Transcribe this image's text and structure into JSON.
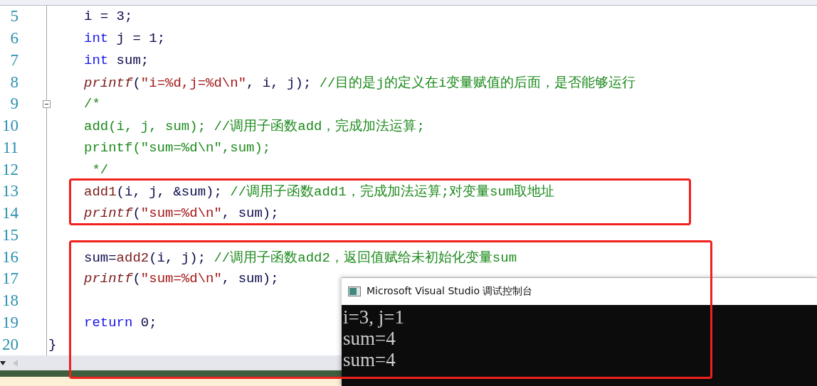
{
  "editor": {
    "lines": [
      {
        "number": "5",
        "indented": true,
        "tokens": [
          {
            "kind": "plain",
            "text": "i = 3;"
          }
        ]
      },
      {
        "number": "6",
        "indented": true,
        "tokens": [
          {
            "kind": "keyword",
            "text": "int"
          },
          {
            "kind": "plain",
            "text": " j = 1;"
          }
        ]
      },
      {
        "number": "7",
        "indented": true,
        "tokens": [
          {
            "kind": "keyword",
            "text": "int"
          },
          {
            "kind": "plain",
            "text": " sum;"
          }
        ]
      },
      {
        "number": "8",
        "indented": true,
        "tokens": [
          {
            "kind": "libcall",
            "text": "printf"
          },
          {
            "kind": "plain",
            "text": "("
          },
          {
            "kind": "string",
            "text": "\"i=%d,j=%d\\n\""
          },
          {
            "kind": "plain",
            "text": ", i, j); "
          },
          {
            "kind": "comment",
            "text": "//目的是j的定义在i变量赋值的后面，是否能够运行"
          }
        ]
      },
      {
        "number": "9",
        "indented": true,
        "fold_expanded": true,
        "tokens": [
          {
            "kind": "comment",
            "text": "/*"
          }
        ]
      },
      {
        "number": "10",
        "indented": true,
        "tokens": [
          {
            "kind": "comment",
            "text": "add(i, j, sum); //调用子函数add，完成加法运算;"
          }
        ]
      },
      {
        "number": "11",
        "indented": true,
        "tokens": [
          {
            "kind": "comment",
            "text": "printf(\"sum=%d\\n\",sum);"
          }
        ]
      },
      {
        "number": "12",
        "indented": true,
        "tokens": [
          {
            "kind": "comment",
            "text": " */"
          }
        ]
      },
      {
        "number": "13",
        "indented": true,
        "tokens": [
          {
            "kind": "function",
            "text": "add1"
          },
          {
            "kind": "plain",
            "text": "(i, j, &sum); "
          },
          {
            "kind": "comment",
            "text": "//调用子函数add1，完成加法运算;对变量sum取地址"
          }
        ]
      },
      {
        "number": "14",
        "indented": true,
        "tokens": [
          {
            "kind": "libcall",
            "text": "printf"
          },
          {
            "kind": "plain",
            "text": "("
          },
          {
            "kind": "string",
            "text": "\"sum=%d\\n\""
          },
          {
            "kind": "plain",
            "text": ", sum);"
          }
        ]
      },
      {
        "number": "15"
      },
      {
        "number": "16",
        "indented": true,
        "tokens": [
          {
            "kind": "plain",
            "text": "sum="
          },
          {
            "kind": "function",
            "text": "add2"
          },
          {
            "kind": "plain",
            "text": "(i, j); "
          },
          {
            "kind": "comment",
            "text": "//调用子函数add2，返回值赋给未初始化变量sum"
          }
        ]
      },
      {
        "number": "17",
        "indented": true,
        "tokens": [
          {
            "kind": "libcall",
            "text": "printf"
          },
          {
            "kind": "plain",
            "text": "("
          },
          {
            "kind": "string",
            "text": "\"sum=%d\\n\""
          },
          {
            "kind": "plain",
            "text": ", sum);"
          }
        ]
      },
      {
        "number": "18"
      },
      {
        "number": "19",
        "indented": true,
        "tokens": [
          {
            "kind": "keyword",
            "text": "return"
          },
          {
            "kind": "plain",
            "text": " 0;"
          }
        ]
      },
      {
        "number": "20",
        "indented": false,
        "tokens": [
          {
            "kind": "plain",
            "text": "}"
          }
        ]
      }
    ]
  },
  "console": {
    "title": "Microsoft Visual Studio 调试控制台",
    "output": [
      "i=3, j=1",
      "sum=4",
      "sum=4"
    ]
  }
}
